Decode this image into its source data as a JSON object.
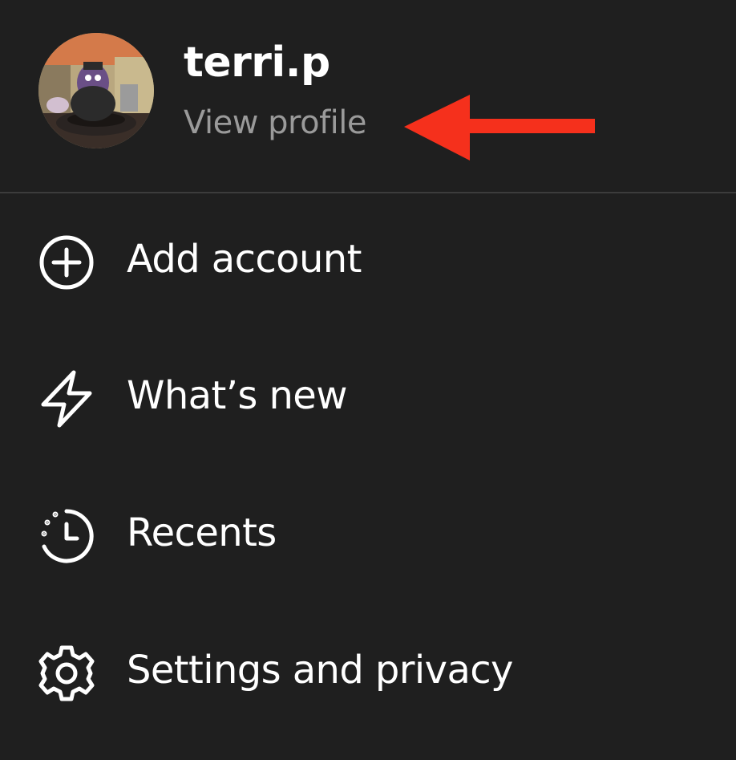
{
  "profile": {
    "username": "terri.p",
    "view_profile_label": "View profile",
    "avatar_icon": "avatar-photo"
  },
  "annotation": {
    "arrow_color": "#f5301c"
  },
  "menu": {
    "items": [
      {
        "label": "Add account",
        "icon": "plus-circle-icon"
      },
      {
        "label": "What’s new",
        "icon": "lightning-bolt-icon"
      },
      {
        "label": "Recents",
        "icon": "clock-history-icon"
      },
      {
        "label": "Settings and privacy",
        "icon": "gear-icon"
      }
    ]
  },
  "colors": {
    "background": "#1f1f1f",
    "primary_text": "#ffffff",
    "secondary_text": "#9a9a9a",
    "divider": "#3c3c3c"
  }
}
